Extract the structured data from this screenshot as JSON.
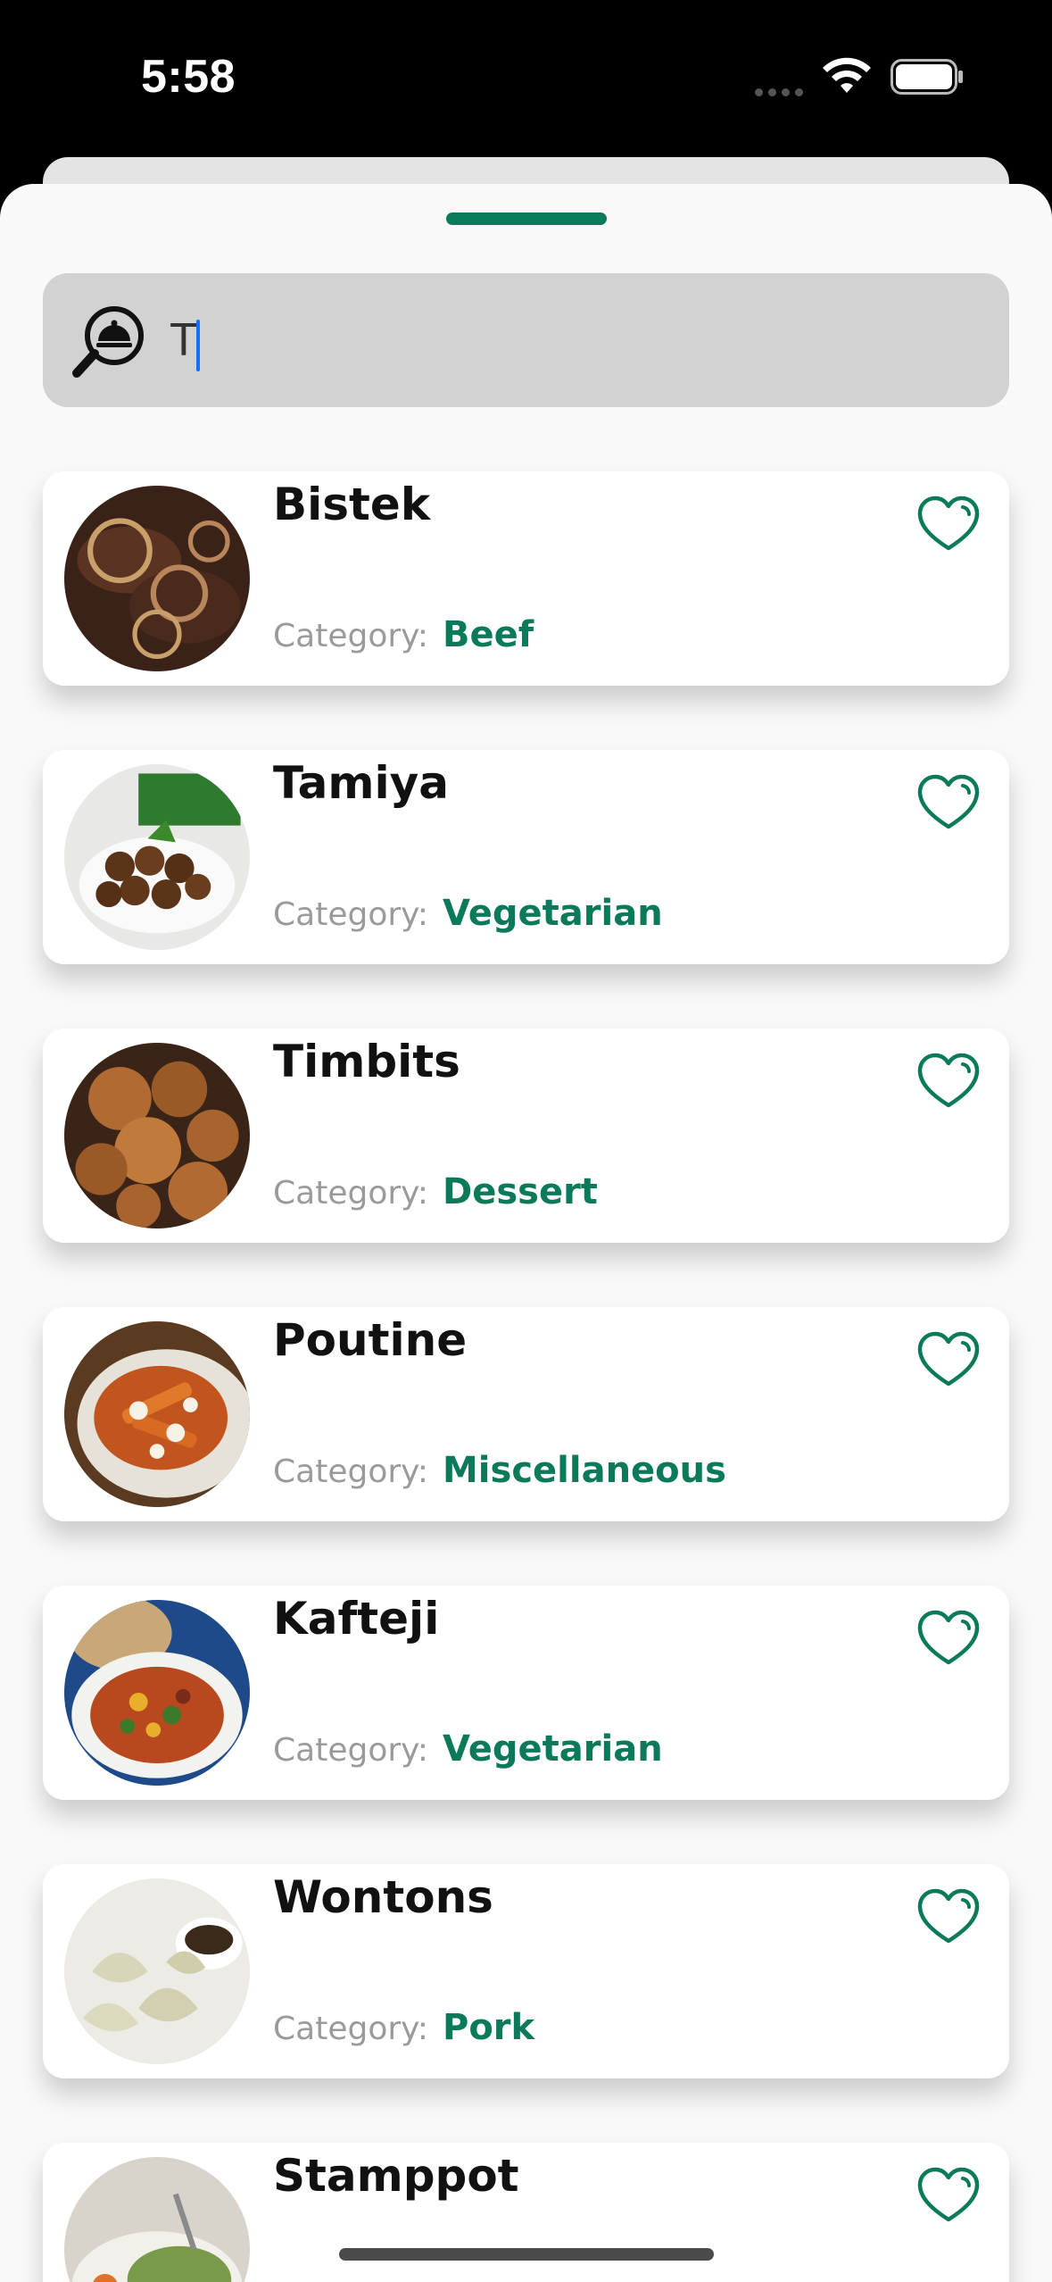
{
  "status_bar": {
    "time": "5:58",
    "icons": [
      "signal-icon",
      "wifi-icon",
      "battery-icon"
    ]
  },
  "search": {
    "value": "T",
    "icon": "search-dish-icon"
  },
  "colors": {
    "accent": "#0a7a5a",
    "label_gray": "#9a9a9a",
    "search_bg": "#d2d2d2"
  },
  "meals": [
    {
      "title": "Bistek",
      "category_label": "Category:",
      "category": "Beef",
      "favorite": false
    },
    {
      "title": "Tamiya",
      "category_label": "Category:",
      "category": "Vegetarian",
      "favorite": false
    },
    {
      "title": "Timbits",
      "category_label": "Category:",
      "category": "Dessert",
      "favorite": false
    },
    {
      "title": "Poutine",
      "category_label": "Category:",
      "category": "Miscellaneous",
      "favorite": false
    },
    {
      "title": "Kafteji",
      "category_label": "Category:",
      "category": "Vegetarian",
      "favorite": false
    },
    {
      "title": "Wontons",
      "category_label": "Category:",
      "category": "Pork",
      "favorite": false
    },
    {
      "title": "Stamppot",
      "category_label": "Category:",
      "category": "",
      "favorite": false
    }
  ]
}
